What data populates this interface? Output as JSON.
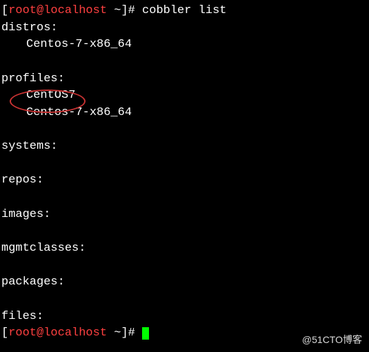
{
  "prompt1": {
    "open": "[",
    "user_host": "root@localhost",
    "path": " ~",
    "close": "]# ",
    "command": "cobbler list"
  },
  "sections": {
    "distros_header": "distros:",
    "distros_item1": "Centos-7-x86_64",
    "profiles_header": "profiles:",
    "profiles_item1": "CentOS7",
    "profiles_item2": "Centos-7-x86_64",
    "systems_header": "systems:",
    "repos_header": "repos:",
    "images_header": "images:",
    "mgmtclasses_header": "mgmtclasses:",
    "packages_header": "packages:",
    "files_header": "files:"
  },
  "prompt2": {
    "open": "[",
    "user_host": "root@localhost",
    "path": " ~",
    "close": "]# "
  },
  "watermark": "@51CTO博客"
}
